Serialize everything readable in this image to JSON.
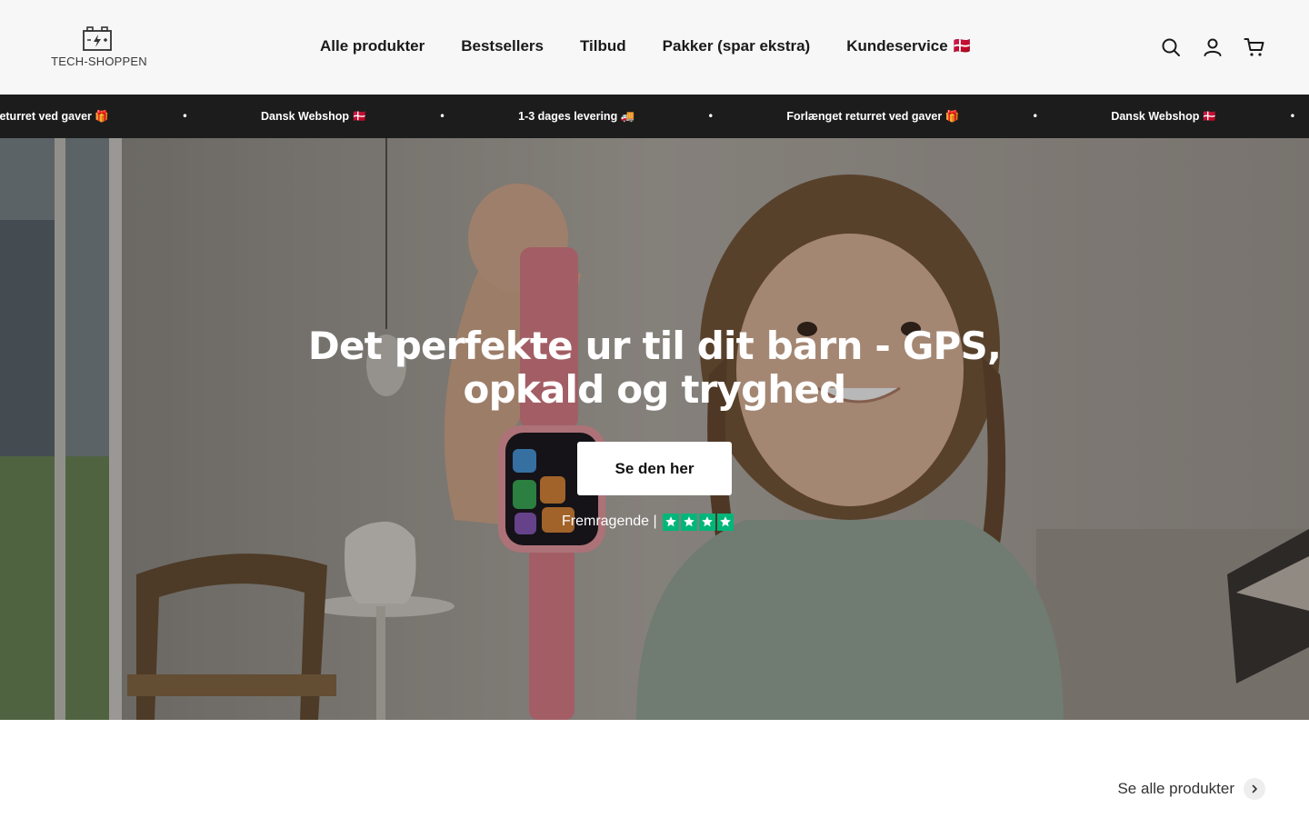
{
  "header": {
    "logo_text": "TECH-SHOPPEN",
    "nav": [
      {
        "label": "Alle produkter"
      },
      {
        "label": "Bestsellers"
      },
      {
        "label": "Tilbud"
      },
      {
        "label": "Pakker (spar ekstra)"
      },
      {
        "label": "Kundeservice 🇩🇰"
      }
    ],
    "icons": [
      "search-icon",
      "account-icon",
      "cart-icon"
    ]
  },
  "announcement": {
    "items": [
      "Forlænget returret ved gaver 🎁",
      "Dansk Webshop 🇩🇰",
      "1-3 dages levering 🚚",
      "Forlænget returret ved gaver 🎁",
      "Dansk Webshop 🇩🇰"
    ],
    "separator": "•"
  },
  "hero": {
    "title": "Det perfekte ur til dit barn - GPS, opkald og tryghed",
    "cta_label": "Se den her",
    "rating_label": "Fremragende |",
    "rating_stars": 4,
    "star_color": "#00b67a"
  },
  "collection": {
    "see_all_label": "Se alle produkter"
  },
  "colors": {
    "header_bg": "#f7f7f7",
    "announcement_bg": "#1c1c1c",
    "cta_bg": "#ffffff"
  }
}
